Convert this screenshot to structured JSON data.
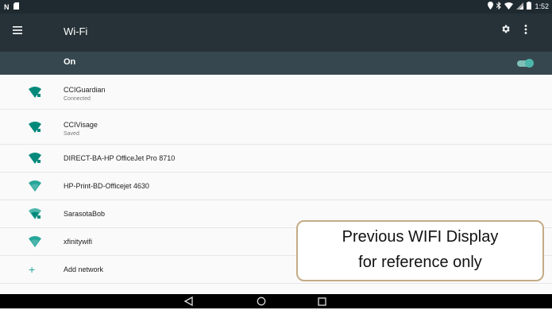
{
  "status_bar": {
    "left_icons": [
      "n-notification-icon",
      "sd-card-icon"
    ],
    "right_icons": [
      "location-icon",
      "bluetooth-icon",
      "wifi-signal-icon",
      "cell-signal-icon",
      "battery-icon"
    ],
    "time": "1:52"
  },
  "toolbar": {
    "title": "Wi-Fi",
    "icons": [
      "menu-icon",
      "settings-gear-icon",
      "more-vert-icon"
    ]
  },
  "switch_bar": {
    "label": "On",
    "toggle_on": true,
    "accent": "#4db6ac"
  },
  "networks": [
    {
      "name": "CCIGuardian",
      "status": "Connected",
      "icon": "wifi-secured-icon"
    },
    {
      "name": "CCIVisage",
      "status": "Saved",
      "icon": "wifi-secured-icon"
    },
    {
      "name": "DIRECT-BA-HP OfficeJet Pro 8710",
      "status": "",
      "icon": "wifi-secured-icon"
    },
    {
      "name": "HP-Print-BD-Officejet 4630",
      "status": "",
      "icon": "wifi-open-icon"
    },
    {
      "name": "SarasotaBob",
      "status": "",
      "icon": "wifi-secured-icon"
    },
    {
      "name": "xfinitywifi",
      "status": "",
      "icon": "wifi-open-icon"
    }
  ],
  "add_network": {
    "label": "Add network",
    "icon": "plus-icon"
  },
  "nav_bar": {
    "icons": [
      "back-icon",
      "home-icon",
      "recents-icon"
    ]
  },
  "overlay": {
    "line1": "Previous WIFI Display",
    "line2": "for reference only"
  },
  "colors": {
    "toolbar": "#263238",
    "switch_bar": "#37474f",
    "wifi_icon": "#00897b",
    "overlay_border": "#c4ab86"
  }
}
